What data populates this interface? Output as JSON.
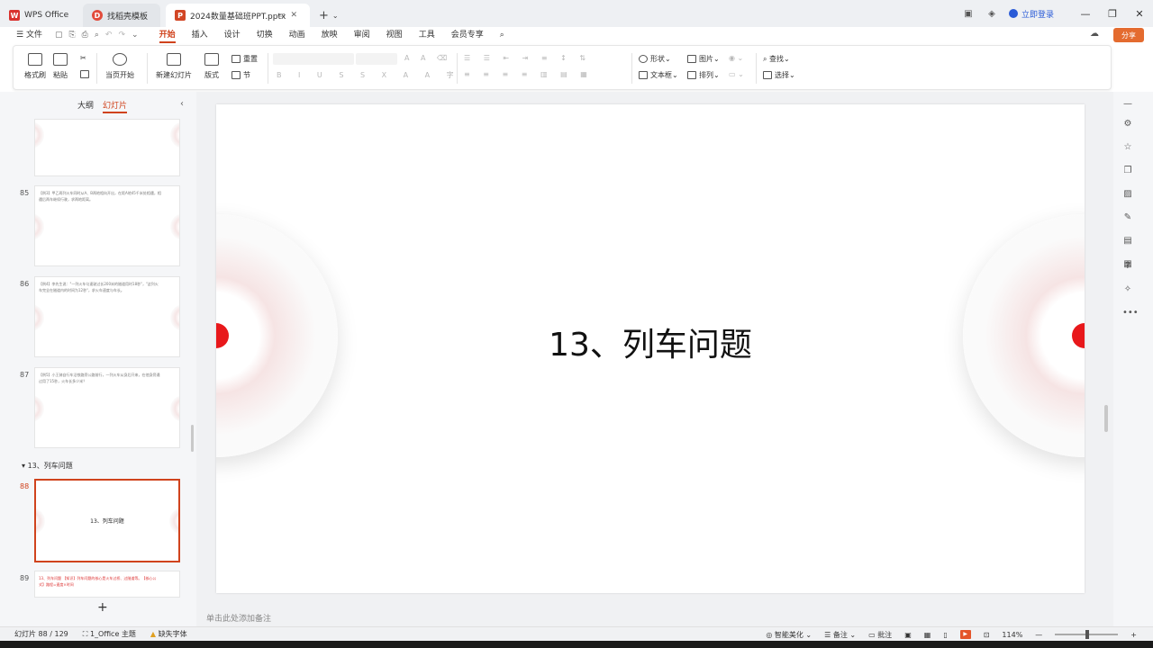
{
  "titlebar": {
    "tabs": [
      {
        "label": "WPS Office",
        "icon": "wps-logo-icon"
      },
      {
        "label": "找稻壳模板",
        "icon": "docer-icon"
      },
      {
        "label": "2024数量基础班PPT.pptx",
        "icon": "ppt-file-icon"
      }
    ],
    "login": "立即登录"
  },
  "menubar": {
    "file": "文件",
    "items": [
      "开始",
      "插入",
      "设计",
      "切换",
      "动画",
      "放映",
      "审阅",
      "视图",
      "工具",
      "会员专享"
    ],
    "active": "开始",
    "share": "分享"
  },
  "ribbon": {
    "format_painter": "格式刷",
    "paste": "粘贴",
    "from_current": "当页开始",
    "new_slide": "新建幻灯片",
    "layout": "版式",
    "reset": "重置",
    "section": "节",
    "shape": "形状",
    "picture": "图片",
    "textbox": "文本框",
    "arrange": "排列",
    "find": "查找",
    "select": "选择"
  },
  "leftpanel": {
    "tab_outline": "大纲",
    "tab_slides": "幻灯片",
    "section_label": "13、列车问题",
    "slides": [
      {
        "num": "85",
        "text": "【例3】甲乙两列火车同时从A、B两地相向开出，在距A地45千米处相遇，相遇后两车继续行驶，求两地距离。",
        "title": ""
      },
      {
        "num": "86",
        "text": "【例4】李先生说：\"一列火车匀速驶过长200米的隧道用时18秒\"，\"这列火车完全在隧道内的时间为12秒\"，求火车速度与车长。",
        "title": ""
      },
      {
        "num": "87",
        "text": "【例5】小王骑自行车沿铁路旁公路前行，一列火车从身后开来，在他身旁通过用了15秒，火车长多少米？",
        "title": ""
      },
      {
        "num": "88",
        "text": "",
        "title": "13、列车问题"
      },
      {
        "num": "89",
        "text": "13、列车问题 【知识】列车问题的核心是火车过桥、过隧道等。【核心公式】路程=速度×时间",
        "title": ""
      }
    ]
  },
  "slide": {
    "title": "13、列车问题"
  },
  "notes": {
    "placeholder": "单击此处添加备注"
  },
  "statusbar": {
    "slide_counter": "幻灯片 88 / 129",
    "theme": "1_Office 主题",
    "missing_font": "缺失字体",
    "smart_beautify": "智能美化",
    "notes": "备注",
    "comments": "批注",
    "zoom": "114%"
  }
}
